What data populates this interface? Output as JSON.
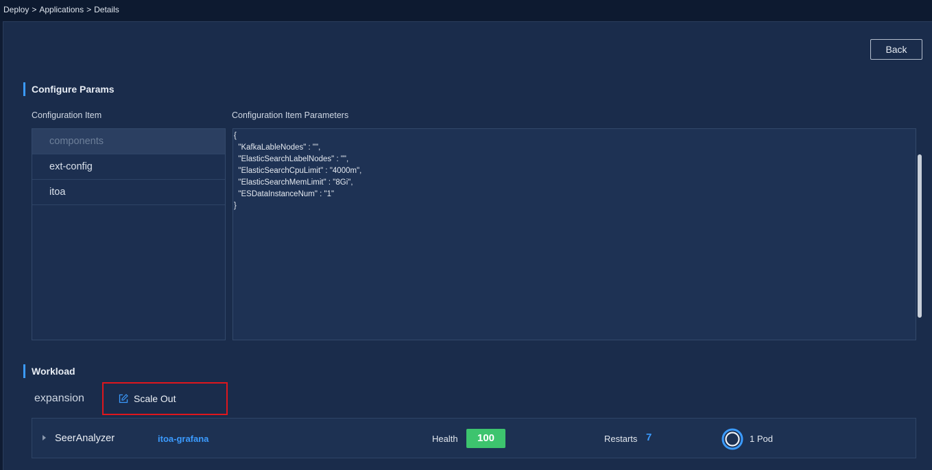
{
  "breadcrumb": {
    "items": [
      "Deploy",
      ">",
      "Applications",
      ">",
      "Details"
    ]
  },
  "header": {
    "back_label": "Back"
  },
  "configure": {
    "title": "Configure Params",
    "items_header": "Configuration Item",
    "params_header": "Configuration Item Parameters",
    "items": [
      {
        "label": "components",
        "selected": true
      },
      {
        "label": "ext-config",
        "selected": false
      },
      {
        "label": "itoa",
        "selected": false
      }
    ],
    "params_lines": [
      "{",
      "  \"KafkaLableNodes\" : \"\",",
      "  \"ElasticSearchLabelNodes\" : \"\",",
      "  \"ElasticSearchCpuLimit\" : \"4000m\",",
      "  \"ElasticSearchMemLimit\" : \"8Gi\",",
      "  \"ESDataInstanceNum\" : \"1\"",
      "}"
    ]
  },
  "workload": {
    "title": "Workload",
    "expansion_label": "expansion",
    "scale_out_label": "Scale Out",
    "scale_out_icon": "edit-icon",
    "row": {
      "name": "SeerAnalyzer",
      "link": "itoa-grafana",
      "health_label": "Health",
      "health_value": "100",
      "restarts_label": "Restarts",
      "restarts_value": "7",
      "pods_label": "1 Pod"
    }
  },
  "colors": {
    "accent": "#3b9bff",
    "health_green": "#3dc46e",
    "highlight_red": "#e0161c",
    "background": "#1a2c4b"
  }
}
